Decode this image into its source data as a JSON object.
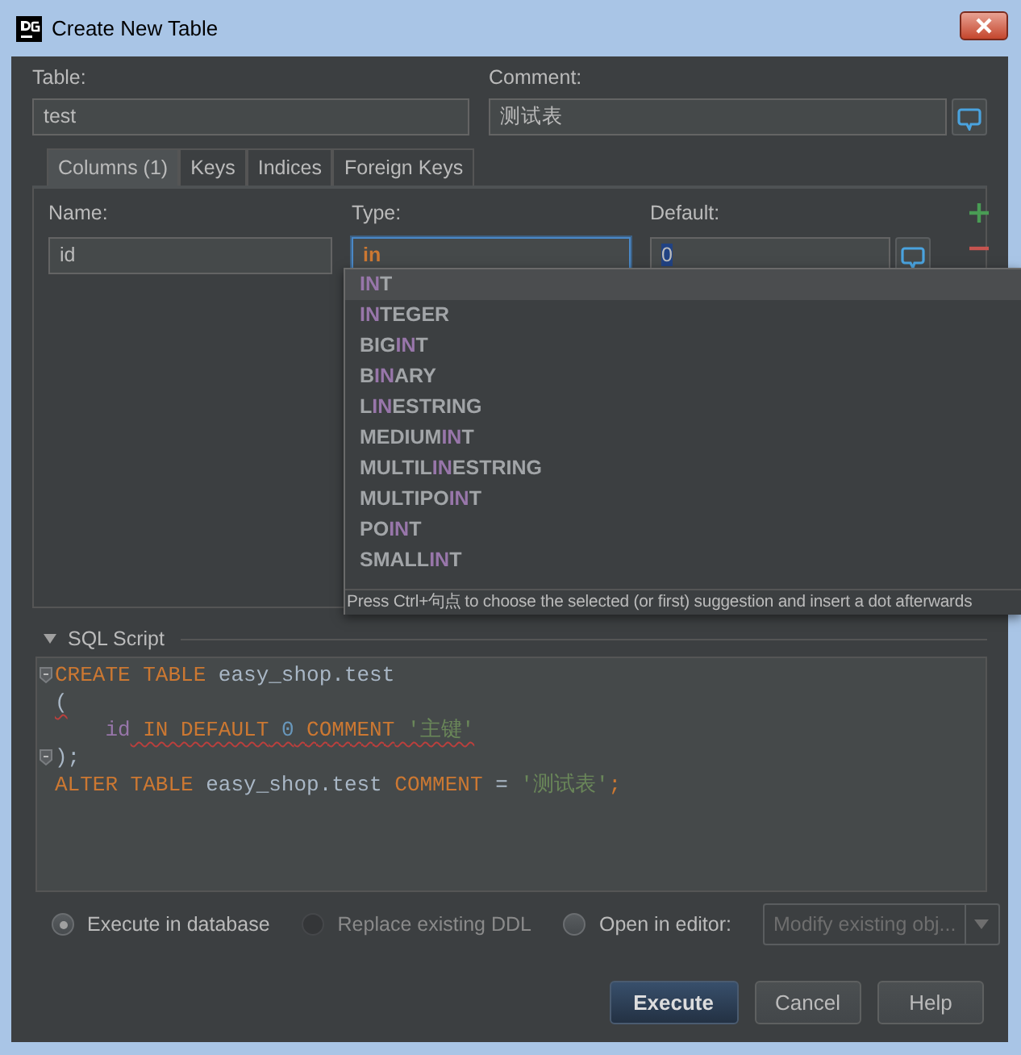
{
  "window": {
    "title": "Create New Table"
  },
  "table_field": {
    "label": "Table:",
    "value": "test"
  },
  "comment_field": {
    "label": "Comment:",
    "value": "测试表"
  },
  "tabs": [
    {
      "label": "Columns (1)",
      "selected": true
    },
    {
      "label": "Keys",
      "selected": false
    },
    {
      "label": "Indices",
      "selected": false
    },
    {
      "label": "Foreign Keys",
      "selected": false
    }
  ],
  "column_editor": {
    "name": {
      "label": "Name:",
      "value": "id",
      "focused": false
    },
    "type": {
      "label": "Type:",
      "value": "in",
      "focused": true
    },
    "default": {
      "label": "Default:",
      "value": "0",
      "focused": false
    }
  },
  "completion": {
    "items": [
      {
        "match": "IN",
        "after": "T",
        "selected": true
      },
      {
        "match": "IN",
        "after": "TEGER",
        "selected": false
      },
      {
        "before": "BIG",
        "match": "IN",
        "after": "T",
        "selected": false
      },
      {
        "before": "B",
        "match": "IN",
        "after": "ARY",
        "selected": false
      },
      {
        "before": "L",
        "match": "IN",
        "after": "ESTRING",
        "selected": false
      },
      {
        "before": "MEDIUM",
        "match": "IN",
        "after": "T",
        "selected": false
      },
      {
        "before": "MULTIL",
        "match": "IN",
        "after": "ESTRING",
        "selected": false
      },
      {
        "before": "MULTIPO",
        "match": "IN",
        "after": "T",
        "selected": false
      },
      {
        "before": "PO",
        "match": "IN",
        "after": "T",
        "selected": false
      },
      {
        "before": "SMALL",
        "match": "IN",
        "after": "T",
        "selected": false
      }
    ],
    "hint": "Press Ctrl+句点 to choose the selected (or first) suggestion and insert a dot afterwards"
  },
  "sql_script": {
    "title": "SQL Script",
    "expanded": true,
    "lines": [
      {
        "fold": true,
        "tokens": [
          {
            "kind": "keyword",
            "text": "CREATE TABLE",
            "error": false
          },
          {
            "kind": "plain",
            "text": " easy_shop.test",
            "error": false
          }
        ]
      },
      {
        "fold": false,
        "tokens": [
          {
            "kind": "plain",
            "text": "(",
            "error": true
          }
        ]
      },
      {
        "fold": false,
        "tokens": [
          {
            "kind": "column",
            "text": "    id",
            "error": false
          },
          {
            "kind": "keyword",
            "text": " IN DEFAULT",
            "error": true
          },
          {
            "kind": "number",
            "text": " 0",
            "error": true
          },
          {
            "kind": "keyword",
            "text": " COMMENT",
            "error": true
          },
          {
            "kind": "string",
            "text": " '主键'",
            "error": true
          }
        ]
      },
      {
        "fold": true,
        "tokens": [
          {
            "kind": "plain",
            "text": ");",
            "error": false
          }
        ]
      },
      {
        "fold": false,
        "tokens": [
          {
            "kind": "keyword",
            "text": "ALTER TABLE",
            "error": false
          },
          {
            "kind": "plain",
            "text": " easy_shop.test ",
            "error": false
          },
          {
            "kind": "keyword",
            "text": "COMMENT",
            "error": false
          },
          {
            "kind": "plain",
            "text": " = ",
            "error": false
          },
          {
            "kind": "string",
            "text": "'测试表'",
            "error": false
          },
          {
            "kind": "keyword",
            "text": ";",
            "error": false
          }
        ]
      }
    ]
  },
  "options": [
    {
      "label": "Execute in database",
      "selected": true,
      "disabled": false
    },
    {
      "label": "Replace existing DDL",
      "selected": false,
      "disabled": true
    },
    {
      "label": "Open in editor:",
      "selected": false,
      "disabled": false
    }
  ],
  "editor_mode": {
    "value": "Modify existing obj...",
    "disabled": true
  },
  "buttons": [
    {
      "label": "Execute",
      "default": true
    },
    {
      "label": "Cancel",
      "default": false
    },
    {
      "label": "Help",
      "default": false
    }
  ]
}
